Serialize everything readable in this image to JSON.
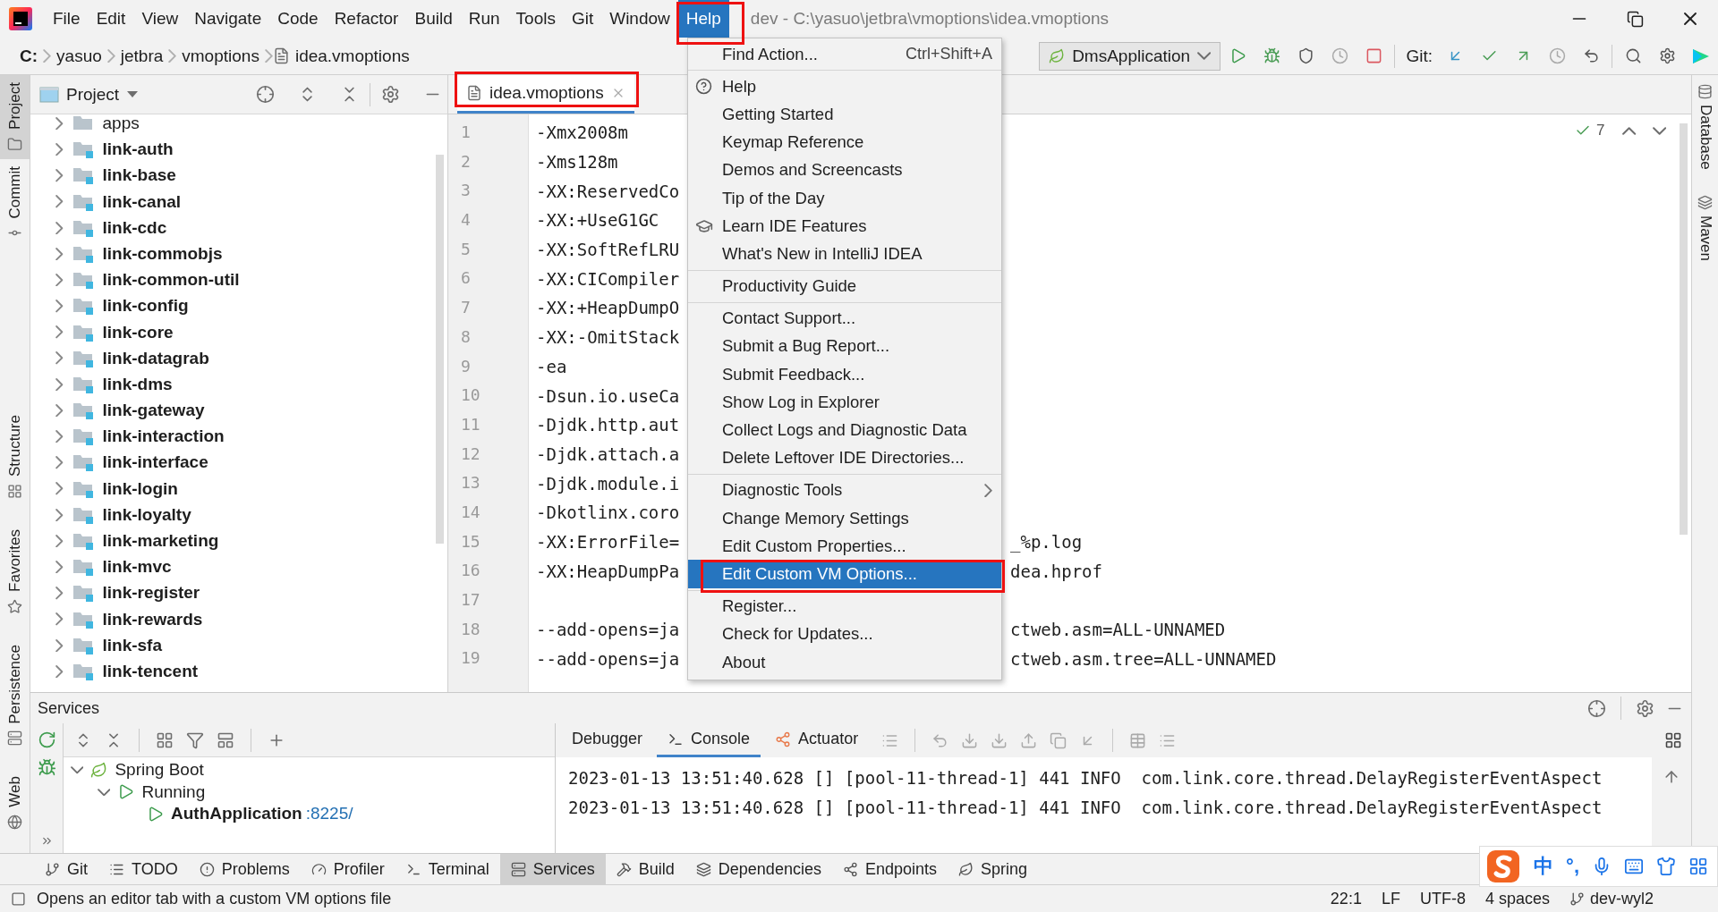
{
  "title_bar": {
    "menus": [
      {
        "label": "File",
        "selected": false,
        "annotated": false
      },
      {
        "label": "Edit",
        "selected": false,
        "annotated": false
      },
      {
        "label": "View",
        "selected": false,
        "annotated": false
      },
      {
        "label": "Navigate",
        "selected": false,
        "annotated": false
      },
      {
        "label": "Code",
        "selected": false,
        "annotated": false
      },
      {
        "label": "Refactor",
        "selected": false,
        "annotated": false
      },
      {
        "label": "Build",
        "selected": false,
        "annotated": false
      },
      {
        "label": "Run",
        "selected": false,
        "annotated": false
      },
      {
        "label": "Tools",
        "selected": false,
        "annotated": false
      },
      {
        "label": "Git",
        "selected": false,
        "annotated": false
      },
      {
        "label": "Window",
        "selected": false,
        "annotated": false
      },
      {
        "label": "Help",
        "selected": true,
        "annotated": true
      }
    ],
    "title": "dev - C:\\yasuo\\jetbra\\vmoptions\\idea.vmoptions"
  },
  "navigation_bar": {
    "breadcrumbs": [
      "C:",
      "yasuo",
      "jetbra",
      "vmoptions",
      "idea.vmoptions"
    ],
    "run_configuration": "DmsApplication",
    "git_label": "Git:"
  },
  "left_stripe": [
    {
      "label": "Project",
      "selected": true
    },
    {
      "label": "Commit",
      "selected": false
    },
    {
      "label": "Structure",
      "selected": false
    },
    {
      "label": "Favorites",
      "selected": false
    },
    {
      "label": "Persistence",
      "selected": false
    },
    {
      "label": "Web",
      "selected": false
    }
  ],
  "right_stripe": [
    "Database",
    "Maven"
  ],
  "project_panel": {
    "title": "Project",
    "items": [
      {
        "label": "apps",
        "kind": "folder",
        "expanded": false
      },
      {
        "label": "link-auth",
        "kind": "module",
        "expanded": false
      },
      {
        "label": "link-base",
        "kind": "module",
        "expanded": false
      },
      {
        "label": "link-canal",
        "kind": "module",
        "expanded": false
      },
      {
        "label": "link-cdc",
        "kind": "module",
        "expanded": false
      },
      {
        "label": "link-commobjs",
        "kind": "module",
        "expanded": false
      },
      {
        "label": "link-common-util",
        "kind": "module",
        "expanded": false
      },
      {
        "label": "link-config",
        "kind": "module",
        "expanded": false
      },
      {
        "label": "link-core",
        "kind": "module",
        "expanded": false
      },
      {
        "label": "link-datagrab",
        "kind": "module",
        "expanded": false
      },
      {
        "label": "link-dms",
        "kind": "module",
        "expanded": false
      },
      {
        "label": "link-gateway",
        "kind": "module",
        "expanded": false
      },
      {
        "label": "link-interaction",
        "kind": "module",
        "expanded": false
      },
      {
        "label": "link-interface",
        "kind": "module",
        "expanded": false
      },
      {
        "label": "link-login",
        "kind": "module",
        "expanded": false
      },
      {
        "label": "link-loyalty",
        "kind": "module",
        "expanded": false
      },
      {
        "label": "link-marketing",
        "kind": "module",
        "expanded": false
      },
      {
        "label": "link-mvc",
        "kind": "module",
        "expanded": false
      },
      {
        "label": "link-register",
        "kind": "module",
        "expanded": false
      },
      {
        "label": "link-rewards",
        "kind": "module",
        "expanded": false
      },
      {
        "label": "link-sfa",
        "kind": "module",
        "expanded": false
      },
      {
        "label": "link-tencent",
        "kind": "module",
        "expanded": false
      }
    ]
  },
  "editor": {
    "tabs": [
      {
        "label": "idea.vmoptions",
        "selected": true,
        "annotated": true
      }
    ],
    "inspections": "7",
    "lines": [
      {
        "number": "1",
        "text": "-Xmx2008m"
      },
      {
        "number": "2",
        "text": "-Xms128m"
      },
      {
        "number": "3",
        "text": "-XX:ReservedCo"
      },
      {
        "number": "4",
        "text": "-XX:+UseG1GC"
      },
      {
        "number": "5",
        "text": "-XX:SoftRefLRU"
      },
      {
        "number": "6",
        "text": "-XX:CICompiler"
      },
      {
        "number": "7",
        "text": "-XX:+HeapDumpO"
      },
      {
        "number": "8",
        "text": "-XX:-OmitStack"
      },
      {
        "number": "9",
        "text": "-ea"
      },
      {
        "number": "10",
        "text": "-Dsun.io.useCa"
      },
      {
        "number": "11",
        "text": "-Djdk.http.aut"
      },
      {
        "number": "12",
        "text": "-Djdk.attach.a"
      },
      {
        "number": "13",
        "text": "-Djdk.module.i"
      },
      {
        "number": "14",
        "text": "-Dkotlinx.coro"
      },
      {
        "number": "15",
        "text": "-XX:ErrorFile=",
        "tail": "_%p.log"
      },
      {
        "number": "16",
        "text": "-XX:HeapDumpPa",
        "tail": "dea.hprof"
      },
      {
        "number": "17"
      },
      {
        "number": "18",
        "text": "--add-opens=ja",
        "tail": "ctweb.asm=ALL-UNNAMED"
      },
      {
        "number": "19",
        "text": "--add-opens=ja",
        "tail": "ctweb.asm.tree=ALL-UNNAMED"
      }
    ]
  },
  "help_menu": {
    "groups": [
      {
        "items": [
          {
            "label": "Find Action...",
            "kind": "shortcut",
            "shortcut": "Ctrl+Shift+A",
            "selected": false,
            "annotated": false
          }
        ]
      },
      {
        "items": [
          {
            "label": "Help",
            "kind": "help",
            "selected": false,
            "annotated": false
          },
          {
            "label": "Getting Started",
            "kind": "plain",
            "selected": false,
            "annotated": false
          },
          {
            "label": "Keymap Reference",
            "kind": "plain",
            "selected": false,
            "annotated": false
          },
          {
            "label": "Demos and Screencasts",
            "kind": "plain",
            "selected": false,
            "annotated": false
          },
          {
            "label": "Tip of the Day",
            "kind": "plain",
            "selected": false,
            "annotated": false
          },
          {
            "label": "Learn IDE Features",
            "kind": "learn",
            "selected": false,
            "annotated": false
          },
          {
            "label": "What's New in IntelliJ IDEA",
            "kind": "plain",
            "selected": false,
            "annotated": false
          }
        ]
      },
      {
        "items": [
          {
            "label": "Productivity Guide",
            "kind": "plain",
            "selected": false,
            "annotated": false
          }
        ]
      },
      {
        "items": [
          {
            "label": "Contact Support...",
            "kind": "plain",
            "selected": false,
            "annotated": false
          },
          {
            "label": "Submit a Bug Report...",
            "kind": "plain",
            "selected": false,
            "annotated": false
          },
          {
            "label": "Submit Feedback...",
            "kind": "plain",
            "selected": false,
            "annotated": false
          },
          {
            "label": "Show Log in Explorer",
            "kind": "plain",
            "selected": false,
            "annotated": false
          },
          {
            "label": "Collect Logs and Diagnostic Data",
            "kind": "plain",
            "selected": false,
            "annotated": false
          },
          {
            "label": "Delete Leftover IDE Directories...",
            "kind": "plain",
            "selected": false,
            "annotated": false
          }
        ]
      },
      {
        "items": [
          {
            "label": "Diagnostic Tools",
            "kind": "submenu",
            "selected": false,
            "annotated": false
          },
          {
            "label": "Change Memory Settings",
            "kind": "plain",
            "selected": false,
            "annotated": false
          },
          {
            "label": "Edit Custom Properties...",
            "kind": "plain",
            "selected": false,
            "annotated": false
          },
          {
            "label": "Edit Custom VM Options...",
            "kind": "plain",
            "selected": true,
            "annotated": true
          }
        ]
      },
      {
        "items": [
          {
            "label": "Register...",
            "kind": "plain",
            "selected": false,
            "annotated": false
          },
          {
            "label": "Check for Updates...",
            "kind": "plain",
            "selected": false,
            "annotated": false
          },
          {
            "label": "About",
            "kind": "plain",
            "selected": false,
            "annotated": false
          }
        ]
      }
    ]
  },
  "services": {
    "title": "Services",
    "tree": [
      {
        "label": "Spring Boot",
        "kind": "group",
        "expanded": true,
        "children": [
          {
            "label": "Running",
            "kind": "status",
            "expanded": true,
            "children": [
              {
                "label": "AuthApplication",
                "kind": "app",
                "port": ":8225/"
              }
            ]
          }
        ]
      }
    ],
    "tabs": [
      {
        "label": "Debugger",
        "selected": false
      },
      {
        "label": "Console",
        "selected": true
      },
      {
        "label": "Actuator",
        "selected": false
      }
    ],
    "console_lines": [
      "2023-01-13 13:51:40.628 [] [pool-11-thread-1] 441 INFO  com.link.core.thread.DelayRegisterEventAspect",
      "2023-01-13 13:51:40.628 [] [pool-11-thread-1] 441 INFO  com.link.core.thread.DelayRegisterEventAspect"
    ]
  },
  "tool_window_bar": [
    {
      "label": "Git",
      "selected": false
    },
    {
      "label": "TODO",
      "selected": false
    },
    {
      "label": "Problems",
      "selected": false
    },
    {
      "label": "Profiler",
      "selected": false
    },
    {
      "label": "Terminal",
      "selected": false
    },
    {
      "label": "Services",
      "selected": true
    },
    {
      "label": "Build",
      "selected": false
    },
    {
      "label": "Dependencies",
      "selected": false
    },
    {
      "label": "Endpoints",
      "selected": false
    },
    {
      "label": "Spring",
      "selected": false
    }
  ],
  "status_bar": {
    "message": "Opens an editor tab with a custom VM options file",
    "position": "22:1",
    "line_separator": "LF",
    "encoding": "UTF-8",
    "indent": "4 spaces",
    "branch": "dev-wyl2"
  },
  "input_method_bar": {
    "language": "中",
    "punctuation": "°,"
  }
}
